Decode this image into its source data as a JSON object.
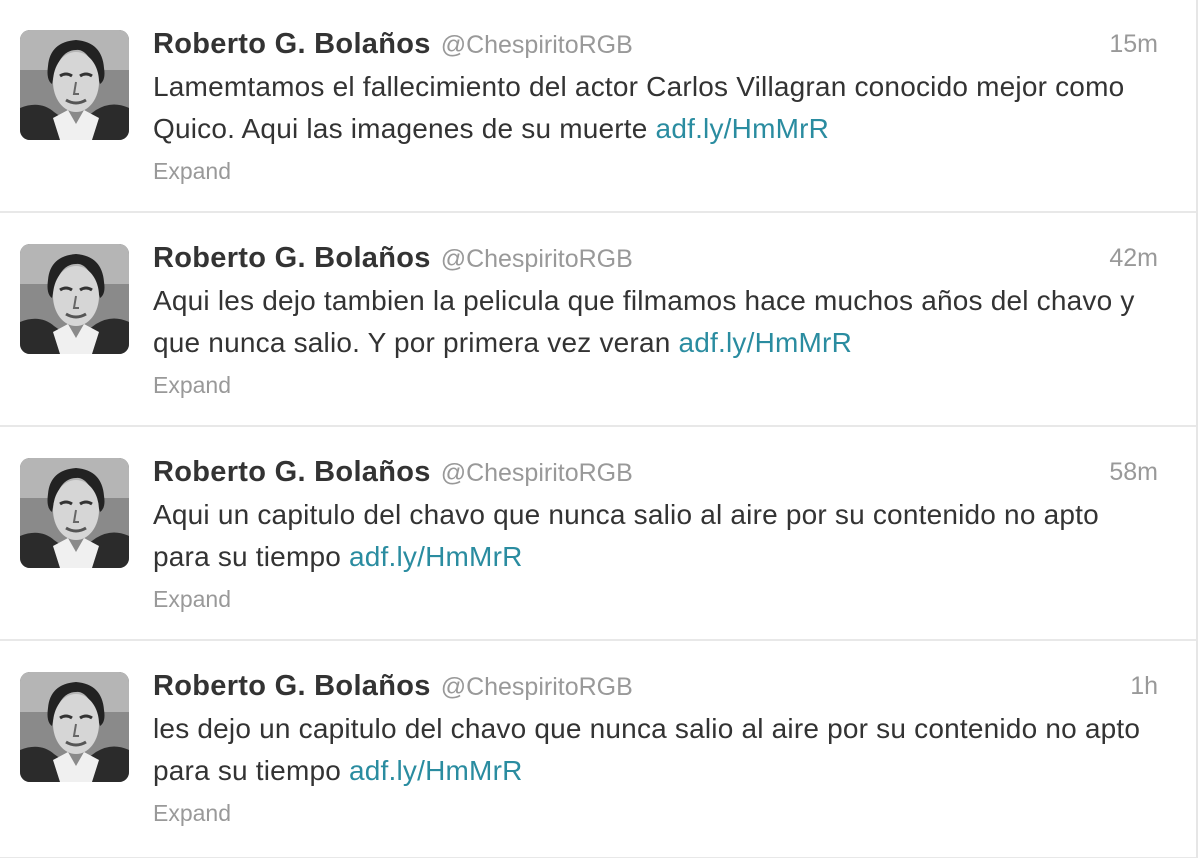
{
  "tweets": [
    {
      "fullname": "Roberto G. Bolaños",
      "username": "@ChespiritoRGB",
      "time": "15m",
      "text": "Lamemtamos el fallecimiento del actor Carlos Villagran conocido mejor como Quico. Aqui las imagenes de su muerte ",
      "link": "adf.ly/HmMrR",
      "expand": "Expand"
    },
    {
      "fullname": "Roberto G. Bolaños",
      "username": "@ChespiritoRGB",
      "time": "42m",
      "text": "Aqui les dejo tambien la pelicula que filmamos hace muchos años del chavo y que nunca salio. Y por primera vez veran ",
      "link": "adf.ly/HmMrR",
      "expand": "Expand"
    },
    {
      "fullname": "Roberto G. Bolaños",
      "username": "@ChespiritoRGB",
      "time": "58m",
      "text": "Aqui un capitulo del chavo que nunca salio al aire por su contenido no apto para su tiempo ",
      "link": "adf.ly/HmMrR",
      "expand": "Expand"
    },
    {
      "fullname": "Roberto G. Bolaños",
      "username": "@ChespiritoRGB",
      "time": "1h",
      "text": "les dejo un capitulo del chavo que nunca salio al aire por su contenido no apto para su tiempo ",
      "link": "adf.ly/HmMrR",
      "expand": "Expand"
    }
  ],
  "colors": {
    "link": "#2a8ca0",
    "muted": "#999999",
    "text": "#333333"
  }
}
